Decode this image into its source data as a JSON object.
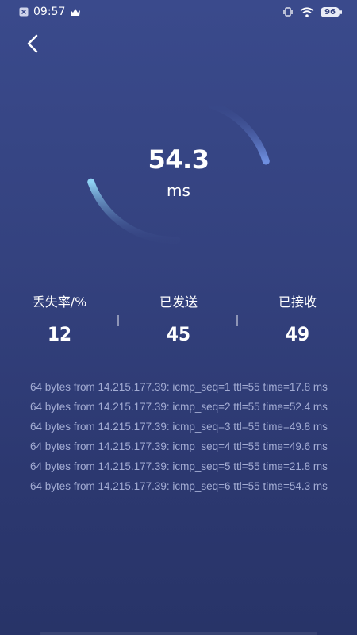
{
  "status_bar": {
    "time": "09:57",
    "battery": "96"
  },
  "gauge": {
    "value": "54.3",
    "unit": "ms"
  },
  "stats": [
    {
      "label": "丢失率/%",
      "value": "12"
    },
    {
      "label": "已发送",
      "value": "45"
    },
    {
      "label": "已接收",
      "value": "49"
    }
  ],
  "log": [
    "64 bytes from 14.215.177.39: icmp_seq=1 ttl=55 time=17.8 ms",
    "64 bytes from 14.215.177.39: icmp_seq=2 ttl=55 time=52.4 ms",
    "64 bytes from 14.215.177.39: icmp_seq=3 ttl=55 time=49.8 ms",
    "64 bytes from 14.215.177.39: icmp_seq=4 ttl=55 time=49.6 ms",
    "64 bytes from 14.215.177.39: icmp_seq=5 ttl=55 time=21.8 ms",
    "64 bytes from 14.215.177.39: icmp_seq=6 ttl=55 time=54.3 ms"
  ],
  "icons": {
    "notification": "close-box-icon",
    "crown": "crown-icon",
    "vibrate": "vibrate-icon",
    "wifi": "wifi-icon",
    "battery": "battery-icon",
    "back": "chevron-left-icon"
  }
}
